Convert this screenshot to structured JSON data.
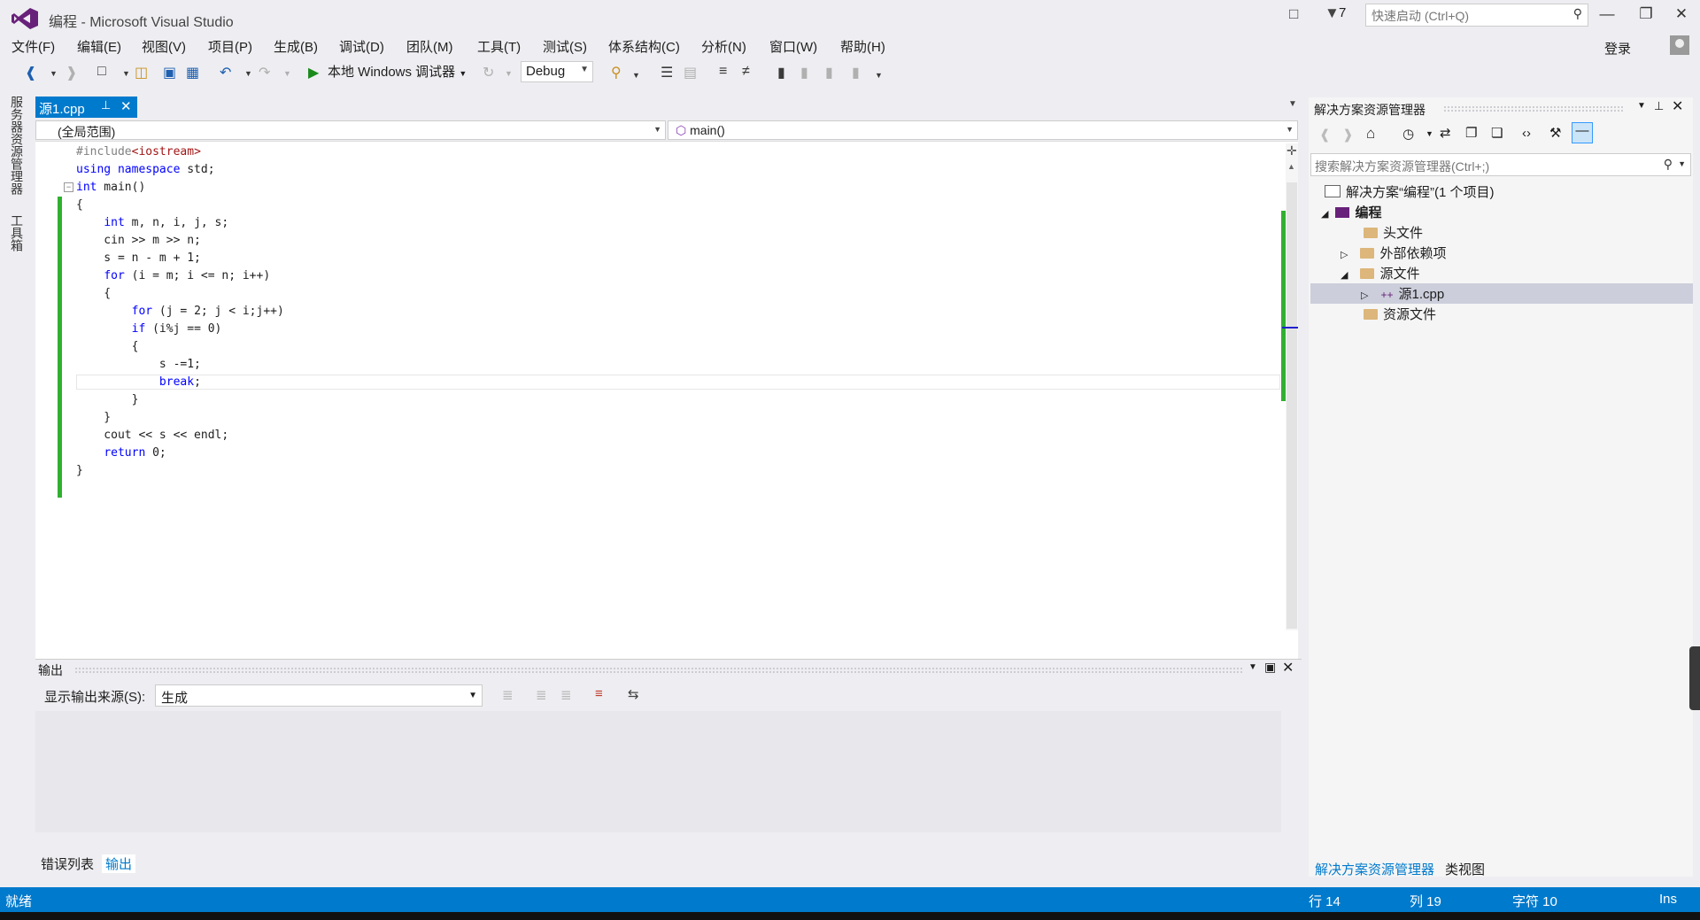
{
  "app": {
    "title": "编程 - Microsoft Visual Studio",
    "notification_count": "7",
    "quick_launch_placeholder": "快速启动 (Ctrl+Q)",
    "login": "登录"
  },
  "menu": [
    "文件(F)",
    "编辑(E)",
    "视图(V)",
    "项目(P)",
    "生成(B)",
    "调试(D)",
    "团队(M)",
    "工具(T)",
    "测试(S)",
    "体系结构(C)",
    "分析(N)",
    "窗口(W)",
    "帮助(H)"
  ],
  "toolbar": {
    "debugger_label": "本地 Windows 调试器",
    "configuration": "Debug"
  },
  "left_strip": {
    "server_explorer": "服务器资源管理器",
    "toolbox": "工具箱"
  },
  "editor": {
    "tab_label": "源1.cpp",
    "scope": "(全局范围)",
    "function": "main()",
    "code_lines": [
      "#include<iostream>",
      "using namespace std;",
      "int main()",
      "{",
      "    int m, n, i, j, s;",
      "    cin >> m >> n;",
      "    s = n - m + 1;",
      "    for (i = m; i <= n; i++)",
      "    {",
      "        for (j = 2; j < i;j++)",
      "        if (i%j == 0)",
      "        {",
      "            s -=1;",
      "            break;",
      "        }",
      "    }",
      "    cout << s << endl;",
      "    return 0;",
      "}"
    ]
  },
  "output": {
    "title": "输出",
    "source_label": "显示输出来源(S):",
    "source_value": "生成",
    "bottom_tabs": [
      "错误列表",
      "输出"
    ]
  },
  "solution_explorer": {
    "title": "解决方案资源管理器",
    "search_placeholder": "搜索解决方案资源管理器(Ctrl+;)",
    "solution": "解决方案“编程”(1 个项目)",
    "project": "编程",
    "nodes": [
      "头文件",
      "外部依赖项",
      "源文件",
      "源1.cpp",
      "资源文件"
    ],
    "bottom_tabs": [
      "解决方案资源管理器",
      "类视图"
    ]
  },
  "status": {
    "ready": "就绪",
    "line": "行 14",
    "col": "列 19",
    "char": "字符 10",
    "mode": "Ins"
  },
  "colors": {
    "accent": "#007acc",
    "keyword": "#0000ff",
    "include_string": "#a31515",
    "change_bar": "#30b030"
  }
}
